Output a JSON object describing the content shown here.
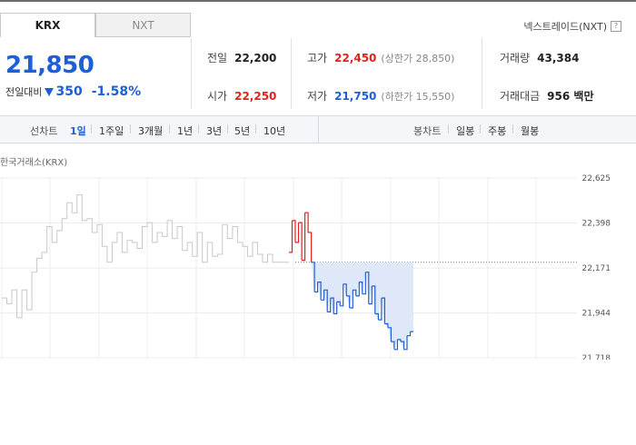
{
  "tabs": [
    {
      "label": "KRX",
      "active": true
    },
    {
      "label": "NXT",
      "active": false
    }
  ],
  "nxt_link": {
    "label": "넥스트레이드(NXT)",
    "icon": "question-icon"
  },
  "price": {
    "current": "21,850",
    "change_label": "전일대비",
    "change_value": "350",
    "change_direction": "down",
    "change_pct": "-1.58%"
  },
  "stats": {
    "prev_close": {
      "label": "전일",
      "value": "22,200"
    },
    "high": {
      "label": "고가",
      "value": "22,450",
      "sub_label": "상한가",
      "sub_value": "28,850"
    },
    "volume": {
      "label": "거래량",
      "value": "43,384"
    },
    "open": {
      "label": "시가",
      "value": "22,250"
    },
    "low": {
      "label": "저가",
      "value": "21,750",
      "sub_label": "하한가",
      "sub_value": "15,550"
    },
    "amount": {
      "label": "거래대금",
      "value": "956 백만"
    }
  },
  "period_bar": {
    "line_label": "선차트",
    "line_options": [
      "1일",
      "1주일",
      "3개월",
      "1년",
      "3년",
      "5년",
      "10년"
    ],
    "line_active": "1일",
    "candle_label": "봉차트",
    "candle_options": [
      "일봉",
      "주봉",
      "월봉"
    ]
  },
  "chart": {
    "title": "한국거래소(KRX)",
    "y_ticks": [
      "22,625",
      "22,398",
      "22,171",
      "21,944",
      "21,718"
    ],
    "colors": {
      "prev": "#c8c8c8",
      "up": "#e0231f",
      "down": "#1d5fd6",
      "fill": "#dfe8f8"
    }
  },
  "chart_data": {
    "type": "line",
    "title": "한국거래소(KRX)",
    "ylim": [
      21718,
      22625
    ],
    "y_ticks": [
      22625,
      22398,
      22171,
      21944,
      21718
    ],
    "reference_price": 22200,
    "previous_session": [
      22020,
      21990,
      22060,
      21920,
      22060,
      21960,
      22150,
      22220,
      22250,
      22380,
      22300,
      22360,
      22420,
      22500,
      22450,
      22540,
      22410,
      22420,
      22350,
      22390,
      22280,
      22200,
      22300,
      22350,
      22250,
      22310,
      22300,
      22270,
      22380,
      22400,
      22300,
      22350,
      22330,
      22410,
      22320,
      22380,
      22260,
      22300,
      22230,
      22350,
      22200,
      22300,
      22230,
      22240,
      22390,
      22320,
      22380,
      22300,
      22280,
      22230,
      22300,
      22240,
      22200,
      22240,
      22200
    ],
    "current_session": [
      22250,
      22410,
      22300,
      22400,
      22210,
      22450,
      22350,
      22200,
      22050,
      22100,
      22010,
      22060,
      21950,
      22020,
      21940,
      22000,
      21980,
      22090,
      22030,
      21970,
      22060,
      22030,
      22100,
      22040,
      22150,
      21990,
      22080,
      21940,
      21910,
      22020,
      21890,
      21870,
      21800,
      21760,
      21810,
      21800,
      21760,
      21830,
      21850,
      21850
    ]
  }
}
